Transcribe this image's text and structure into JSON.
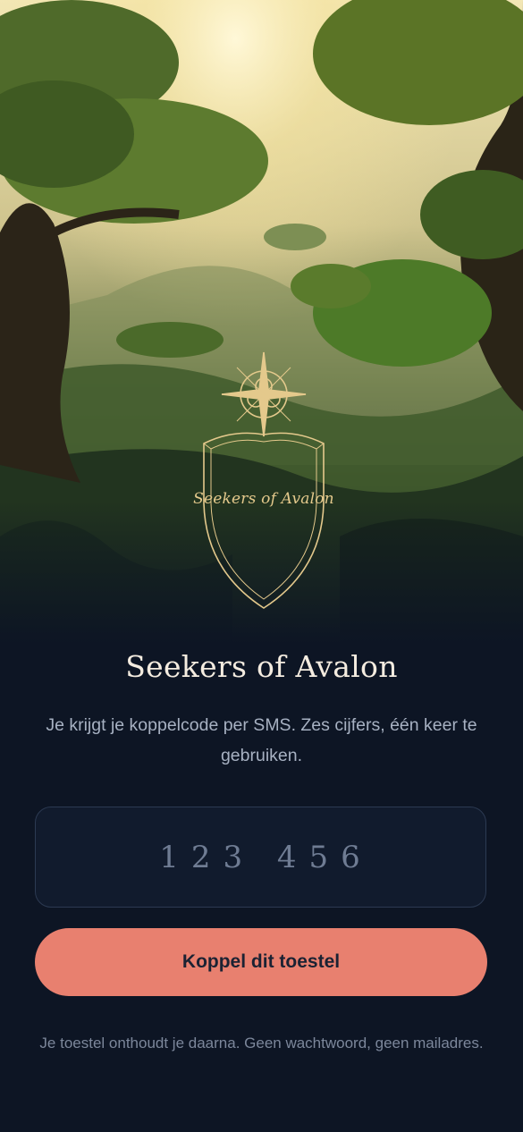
{
  "hero": {
    "emblem_label": "Seekers of Avalon",
    "emblem_icon": "compass-rose-icon"
  },
  "login": {
    "title": "Seekers of Avalon",
    "subtitle": "Je krijgt je koppelcode per SMS. Zes cijfers, één keer te gebruiken.",
    "code_placeholder": "123 456",
    "submit_label": "Koppel dit toestel",
    "footnote": "Je toestel onthoudt je daarna. Geen wachtwoord, geen mailadres."
  },
  "colors": {
    "background": "#0d1524",
    "accent_button": "#e8806f",
    "emblem_gold": "#e4c98c"
  }
}
